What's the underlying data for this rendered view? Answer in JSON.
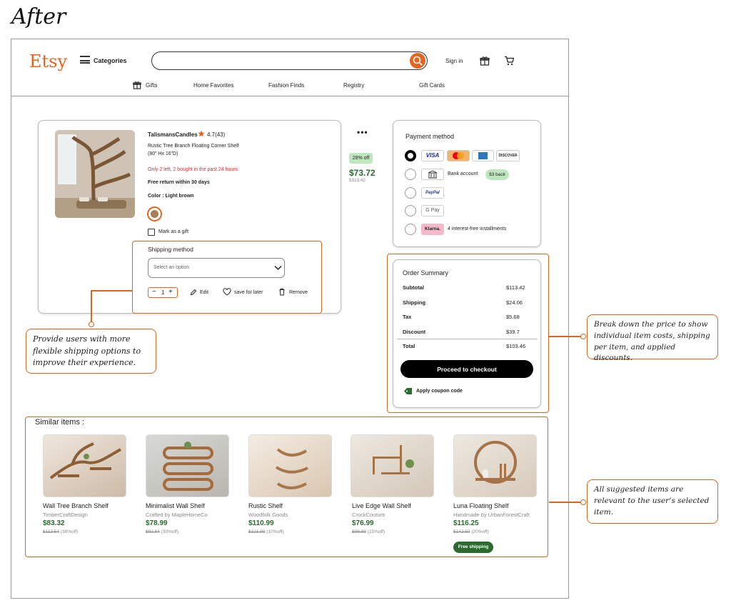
{
  "page_heading": "After",
  "header": {
    "logo": "Etsy",
    "categories_label": "Categories",
    "search_placeholder": "",
    "sign_in": "Sign in",
    "nav": [
      "Gifts",
      "Home Favorites",
      "Fashion Finds",
      "Registry",
      "Gift Cards"
    ]
  },
  "product": {
    "shop_name": "TalismansCandles",
    "rating": "4.7(43)",
    "title_line1": "Rustic Tree Branch Floating Corner Shelf",
    "title_line2": "(80” Hx 16”D)",
    "stock_note": "Only 2 left, 2 bought in the past 24 hours",
    "return_note": "Free return within 30 days",
    "color_label": "Color : Light brown",
    "discount_badge": "28% off",
    "price": "$73.72",
    "original_price": "$113.42",
    "gift_label": "Mark as a gift",
    "shipping_title": "Shipping method",
    "shipping_placeholder": "Select an option",
    "quantity": "1",
    "edit_label": "Edit",
    "save_label": "save for later",
    "remove_label": "Remove"
  },
  "payment": {
    "title": "Payment method",
    "card_logos": [
      "VISA",
      "",
      "",
      "DISCOVER"
    ],
    "bank_label": "Bank account",
    "bank_badge": "$3 back",
    "paypal": "PayPal",
    "gpay": "G Pay",
    "klarna": "Klarna.",
    "klarna_note": "4 interest-free installments"
  },
  "summary": {
    "title": "Order Summary",
    "rows": [
      {
        "label": "Subtotal",
        "value": "$113.42"
      },
      {
        "label": "Shipping",
        "value": "$24.06"
      },
      {
        "label": "Tax",
        "value": "$5.68"
      },
      {
        "label": "Discount",
        "value": "$39.7"
      }
    ],
    "total_label": "Total",
    "total_value": "$103.46",
    "checkout_label": "Proceed to checkout",
    "coupon_label": "Apply coupon code"
  },
  "callouts": {
    "shipping": "Provide users with more flexible shipping options to improve their experience.",
    "price": "Break down the price to show individual item costs, shipping per item, and applied discounts.",
    "similar": "All suggested items are relevant to the user’s selected item."
  },
  "similar": {
    "heading": "Similar items :",
    "items": [
      {
        "name": "Wall Tree Branch Shelf",
        "seller": "TimberCraftDesign",
        "price": "$83.32",
        "was": "$112.54",
        "off": "(36%off)"
      },
      {
        "name": "Minimalist Wall Shelf",
        "seller": "Crafted by MapleHomeCo",
        "price": "$78.99",
        "was": "$92.84",
        "off": "(30%off)"
      },
      {
        "name": "Rustic Shelf",
        "seller": "Woodfolk Goods",
        "price": "$110.99",
        "was": "$121.99",
        "off": "(10%off)"
      },
      {
        "name": "Live Edge Wall Shelf",
        "seller": "CrockCouture",
        "price": "$76.99",
        "was": "$99.99",
        "off": "(15%off)"
      },
      {
        "name": "Luna Floating Shelf",
        "seller": "Handmade by UrbanForestCraft",
        "price": "$116.25",
        "was": "$142.50",
        "off": "(20%off)"
      }
    ],
    "free_shipping": "Free shipping"
  },
  "colors": {
    "accent": "#e5641f",
    "price_green": "#2c6a2f",
    "badge_green": "#bfe7bd",
    "stock_red": "#e02b2b"
  }
}
